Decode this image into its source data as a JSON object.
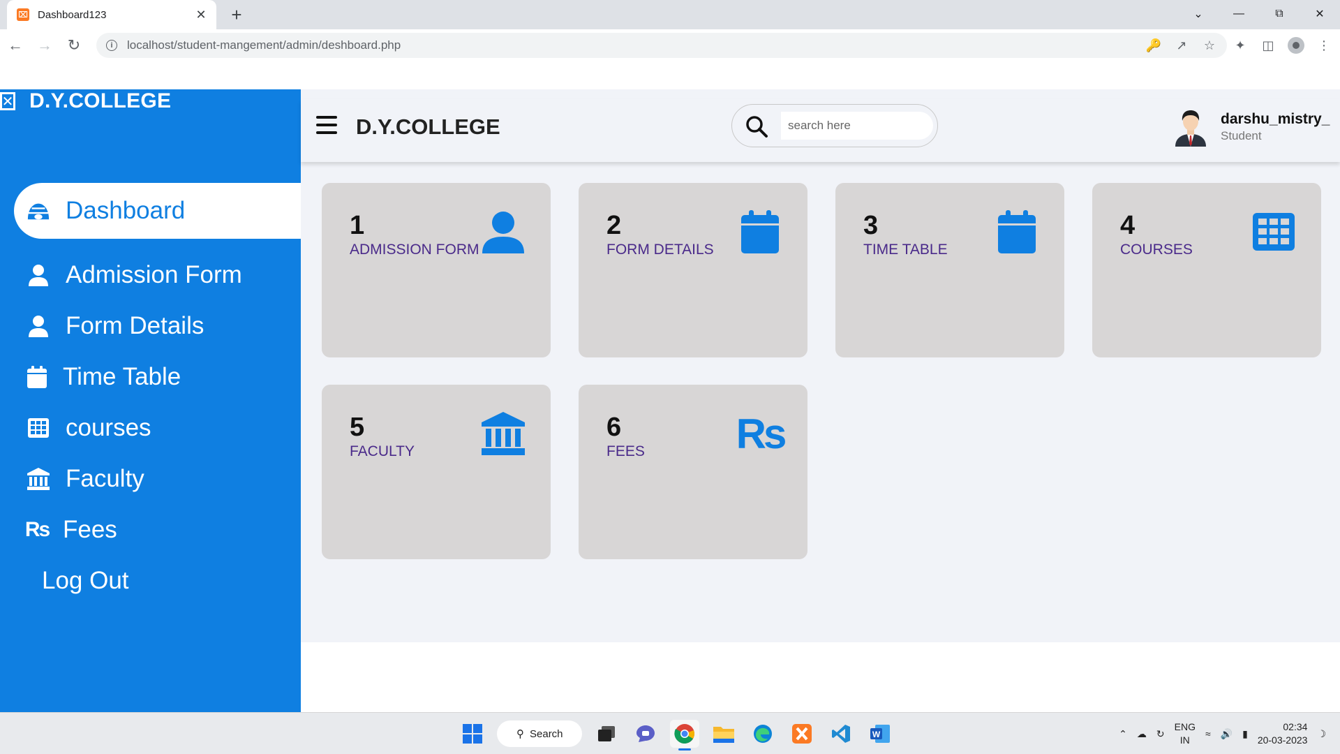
{
  "browser": {
    "tab_title": "Dashboard123",
    "url": "localhost/student-mangement/admin/deshboard.php"
  },
  "sidebar": {
    "brand": "D.Y.COLLEGE",
    "items": [
      {
        "label": "Dashboard",
        "icon": "igloo-icon"
      },
      {
        "label": "Admission Form",
        "icon": "user-icon"
      },
      {
        "label": "Form Details",
        "icon": "user-icon"
      },
      {
        "label": "Time Table",
        "icon": "calendar-icon"
      },
      {
        "label": "courses",
        "icon": "grid-icon"
      },
      {
        "label": "Faculty",
        "icon": "bank-icon"
      },
      {
        "label": "Fees",
        "icon": "rupee-icon"
      },
      {
        "label": "Log Out",
        "icon": ""
      }
    ]
  },
  "topbar": {
    "title": "D.Y.COLLEGE",
    "search_placeholder": "search here",
    "user_name": "darshu_mistry_",
    "user_role": "Student"
  },
  "cards": [
    {
      "num": "1",
      "label": "ADMISSION FORM",
      "icon": "user-icon"
    },
    {
      "num": "2",
      "label": "FORM DETAILS",
      "icon": "calendar-icon"
    },
    {
      "num": "3",
      "label": "TIME TABLE",
      "icon": "calendar-icon"
    },
    {
      "num": "4",
      "label": "COURSES",
      "icon": "grid-icon"
    },
    {
      "num": "5",
      "label": "FACULTY",
      "icon": "bank-icon"
    },
    {
      "num": "6",
      "label": "FEES",
      "icon": "rupee-icon"
    }
  ],
  "taskbar": {
    "search_label": "Search",
    "lang_top": "ENG",
    "lang_bottom": "IN",
    "time": "02:34",
    "date": "20-03-2023"
  },
  "colors": {
    "accent": "#0f7fe1",
    "card_bg": "#d8d6d6",
    "card_label": "#4a2a8a",
    "main_bg": "#f1f3f8"
  }
}
